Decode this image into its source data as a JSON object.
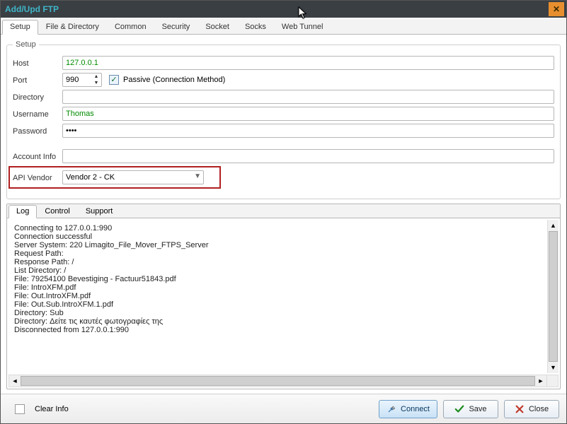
{
  "window": {
    "title": "Add/Upd FTP"
  },
  "main_tabs": [
    "Setup",
    "File & Directory",
    "Common",
    "Security",
    "Socket",
    "Socks",
    "Web Tunnel"
  ],
  "main_tabs_active": 0,
  "setup": {
    "legend": "Setup",
    "labels": {
      "host": "Host",
      "port": "Port",
      "directory": "Directory",
      "username": "Username",
      "password": "Password",
      "account_info": "Account Info",
      "api_vendor": "API Vendor",
      "passive": "Passive (Connection Method)"
    },
    "host": "127.0.0.1",
    "port": "990",
    "passive_checked": true,
    "directory": "",
    "username": "Thomas",
    "password_mask": "••••",
    "account_info": "",
    "api_vendor": "Vendor 2 - CK"
  },
  "log_tabs": [
    "Log",
    "Control",
    "Support"
  ],
  "log_tabs_active": 0,
  "log_lines": [
    "Connecting to 127.0.0.1:990",
    "Connection successful",
    "Server System: 220 Limagito_File_Mover_FTPS_Server",
    "Request Path:",
    "Response Path: /",
    "List Directory: /",
    "File: 79254100 Bevestiging - Factuur51843.pdf",
    "File: IntroXFM.pdf",
    "File: Out.IntroXFM.pdf",
    "File: Out.Sub.IntroXFM.1.pdf",
    "Directory: Sub",
    "Directory: Δείτε τις καυτές φωτογραφίες της",
    "Disconnected from 127.0.0.1:990"
  ],
  "footer": {
    "clear_info": "Clear Info",
    "connect": "Connect",
    "save": "Save",
    "close": "Close"
  }
}
